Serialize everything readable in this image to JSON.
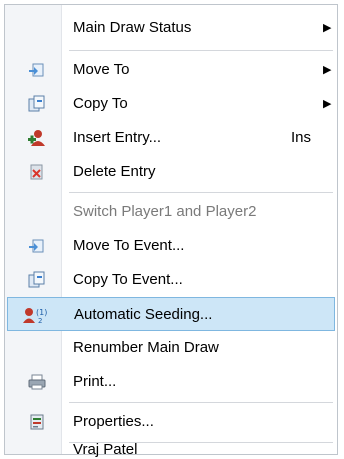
{
  "menu": {
    "items": [
      {
        "label": "Main Draw Status",
        "submenu": true
      },
      {
        "label": "Move To",
        "submenu": true,
        "icon": "move-to-icon"
      },
      {
        "label": "Copy To",
        "submenu": true,
        "icon": "copy-to-icon"
      },
      {
        "label": "Insert Entry...",
        "shortcut": "Ins",
        "icon": "insert-entry-icon"
      },
      {
        "label": "Delete Entry",
        "icon": "delete-entry-icon"
      },
      {
        "label": "Switch Player1 and Player2",
        "disabled": true
      },
      {
        "label": "Move To Event...",
        "icon": "move-to-event-icon"
      },
      {
        "label": "Copy To Event...",
        "icon": "copy-to-event-icon"
      },
      {
        "label": "Automatic Seeding...",
        "highlighted": true,
        "icon": "seeding-icon"
      },
      {
        "label": "Renumber Main Draw"
      },
      {
        "label": "Print...",
        "icon": "printer-icon"
      },
      {
        "label": "Properties...",
        "icon": "properties-icon"
      },
      {
        "label": "Vraj Patel"
      }
    ],
    "arrow": "▶",
    "highlight_color": "#cde6f7"
  }
}
